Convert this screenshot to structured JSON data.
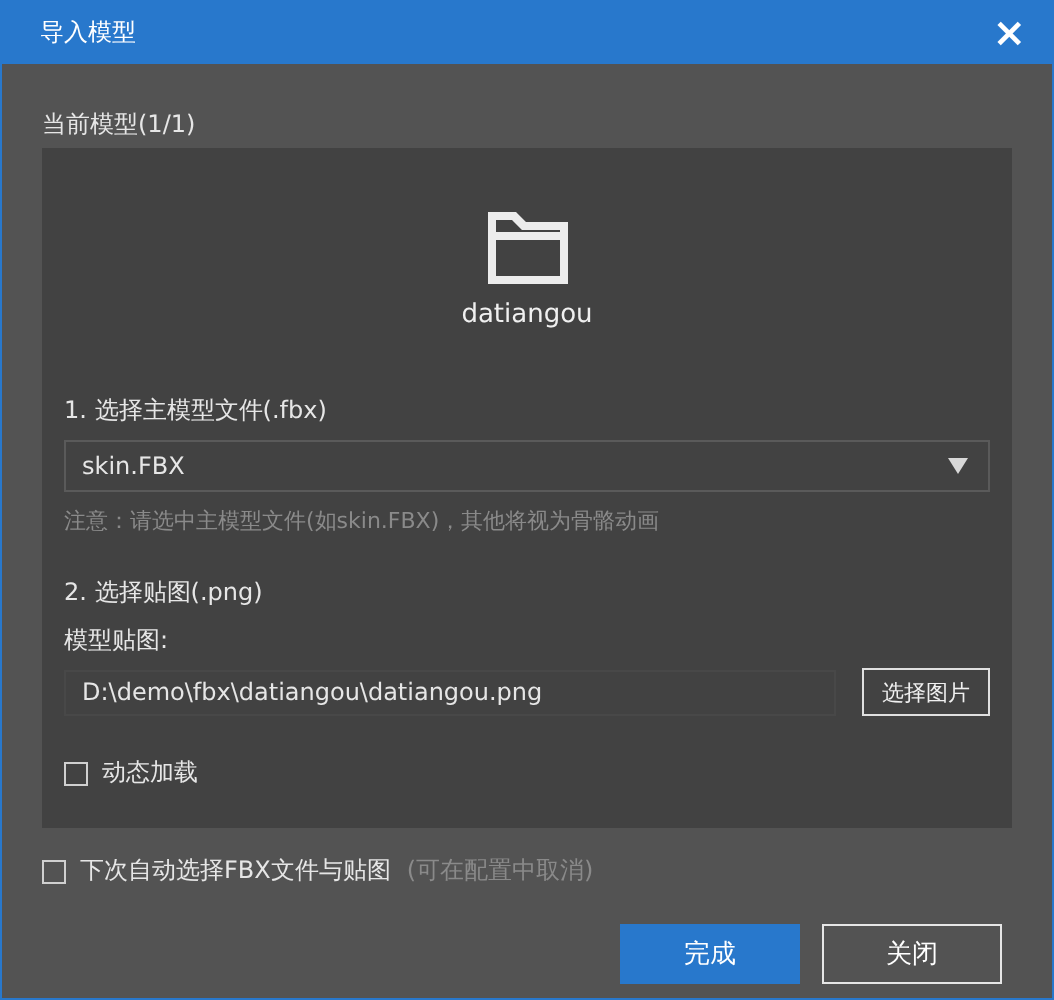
{
  "window": {
    "title": "导入模型",
    "close": "×"
  },
  "current_model_label": "当前模型(1/1)",
  "model": {
    "name": "datiangou"
  },
  "step1": {
    "label": "1. 选择主模型文件(.fbx)",
    "select_value": "skin.FBX",
    "hint": "注意：请选中主模型文件(如skin.FBX)，其他将视为骨骼动画"
  },
  "step2": {
    "label": "2. 选择贴图(.png)",
    "field_label": "模型贴图:",
    "path_value": "D:\\demo\\fbx\\datiangou\\datiangou.png",
    "browse_button": "选择图片"
  },
  "dynamic_load": {
    "label": "动态加载",
    "checked": false
  },
  "auto_select": {
    "label": "下次自动选择FBX文件与贴图",
    "note": "(可在配置中取消)",
    "checked": false
  },
  "buttons": [
    {
      "label": "完成",
      "kind": "primary"
    },
    {
      "label": "关闭",
      "kind": "secondary"
    }
  ]
}
